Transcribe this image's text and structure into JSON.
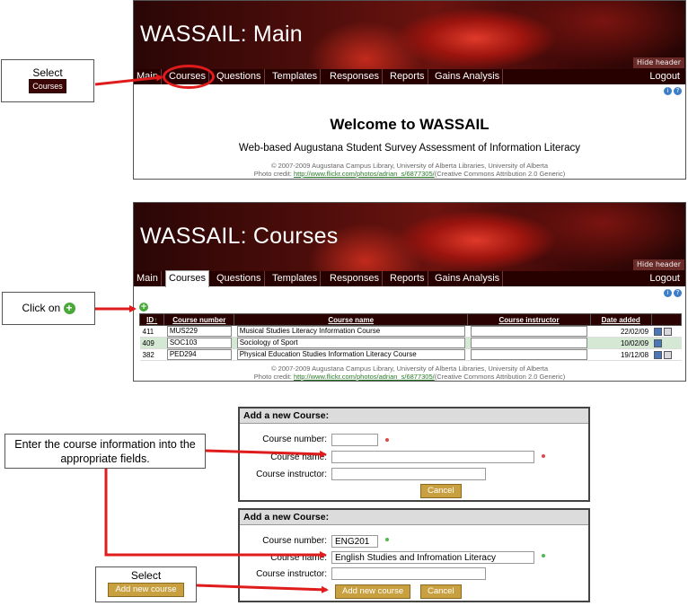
{
  "app": {
    "title_main": "WASSAIL: Main",
    "title_courses": "WASSAIL: Courses",
    "hide_header": "Hide header",
    "logout": "Logout",
    "nav": [
      "Main",
      "Courses",
      "Questions",
      "Templates",
      "Responses",
      "Reports",
      "Gains Analysis"
    ],
    "welcome": "Welcome to WASSAIL",
    "subtitle": "Web-based Augustana Student Survey Assessment of Information Literacy",
    "footer_line1": "© 2007-2009 Augustana Campus Library, University of Alberta Libraries, University of Alberta",
    "footer_credit_prefix": "Photo credit: ",
    "footer_credit_link": "http://www.flickr.com/photos/adrian_s/6877305/",
    "footer_credit_suffix": "(Creative Commons Attribution 2.0 Generic)",
    "icons": [
      "info-icon",
      "help-icon"
    ]
  },
  "callouts": {
    "select_label": "Select",
    "select_courses": "Courses",
    "click_on": "Click on",
    "enter_info": "Enter the course information into the appropriate fields.",
    "select_label_2": "Select",
    "add_new_course": "Add new course"
  },
  "table": {
    "headers": [
      "ID",
      "Course number",
      "Course name",
      "Course instructor",
      "Date added"
    ],
    "rows": [
      {
        "id": "411",
        "number": "MUS229",
        "name": "Musical Studies Literacy Information Course",
        "instructor": "",
        "date": "22/02/09"
      },
      {
        "id": "409",
        "number": "SOC103",
        "name": "Sociology of Sport",
        "instructor": "",
        "date": "10/02/09"
      },
      {
        "id": "382",
        "number": "PED294",
        "name": "Physical Education Studies Information Literacy Course",
        "instructor": "",
        "date": "19/12/08"
      }
    ]
  },
  "form_empty": {
    "title": "Add a new Course:",
    "number_label": "Course number:",
    "name_label": "Course name:",
    "instructor_label": "Course instructor:",
    "number_value": "",
    "name_value": "",
    "instructor_value": "",
    "cancel": "Cancel"
  },
  "form_filled": {
    "title": "Add a new Course:",
    "number_label": "Course number:",
    "name_label": "Course name:",
    "instructor_label": "Course instructor:",
    "number_value": "ENG201",
    "name_value": "English Studies and Infromation Literacy",
    "instructor_value": "",
    "add": "Add new course",
    "cancel": "Cancel"
  },
  "colors": {
    "nav_bg": "#270000",
    "required_empty": "#e04848",
    "required_ok": "#4cba4c",
    "button_gold": "#c8a040",
    "arrow_red": "#e01b1b"
  }
}
